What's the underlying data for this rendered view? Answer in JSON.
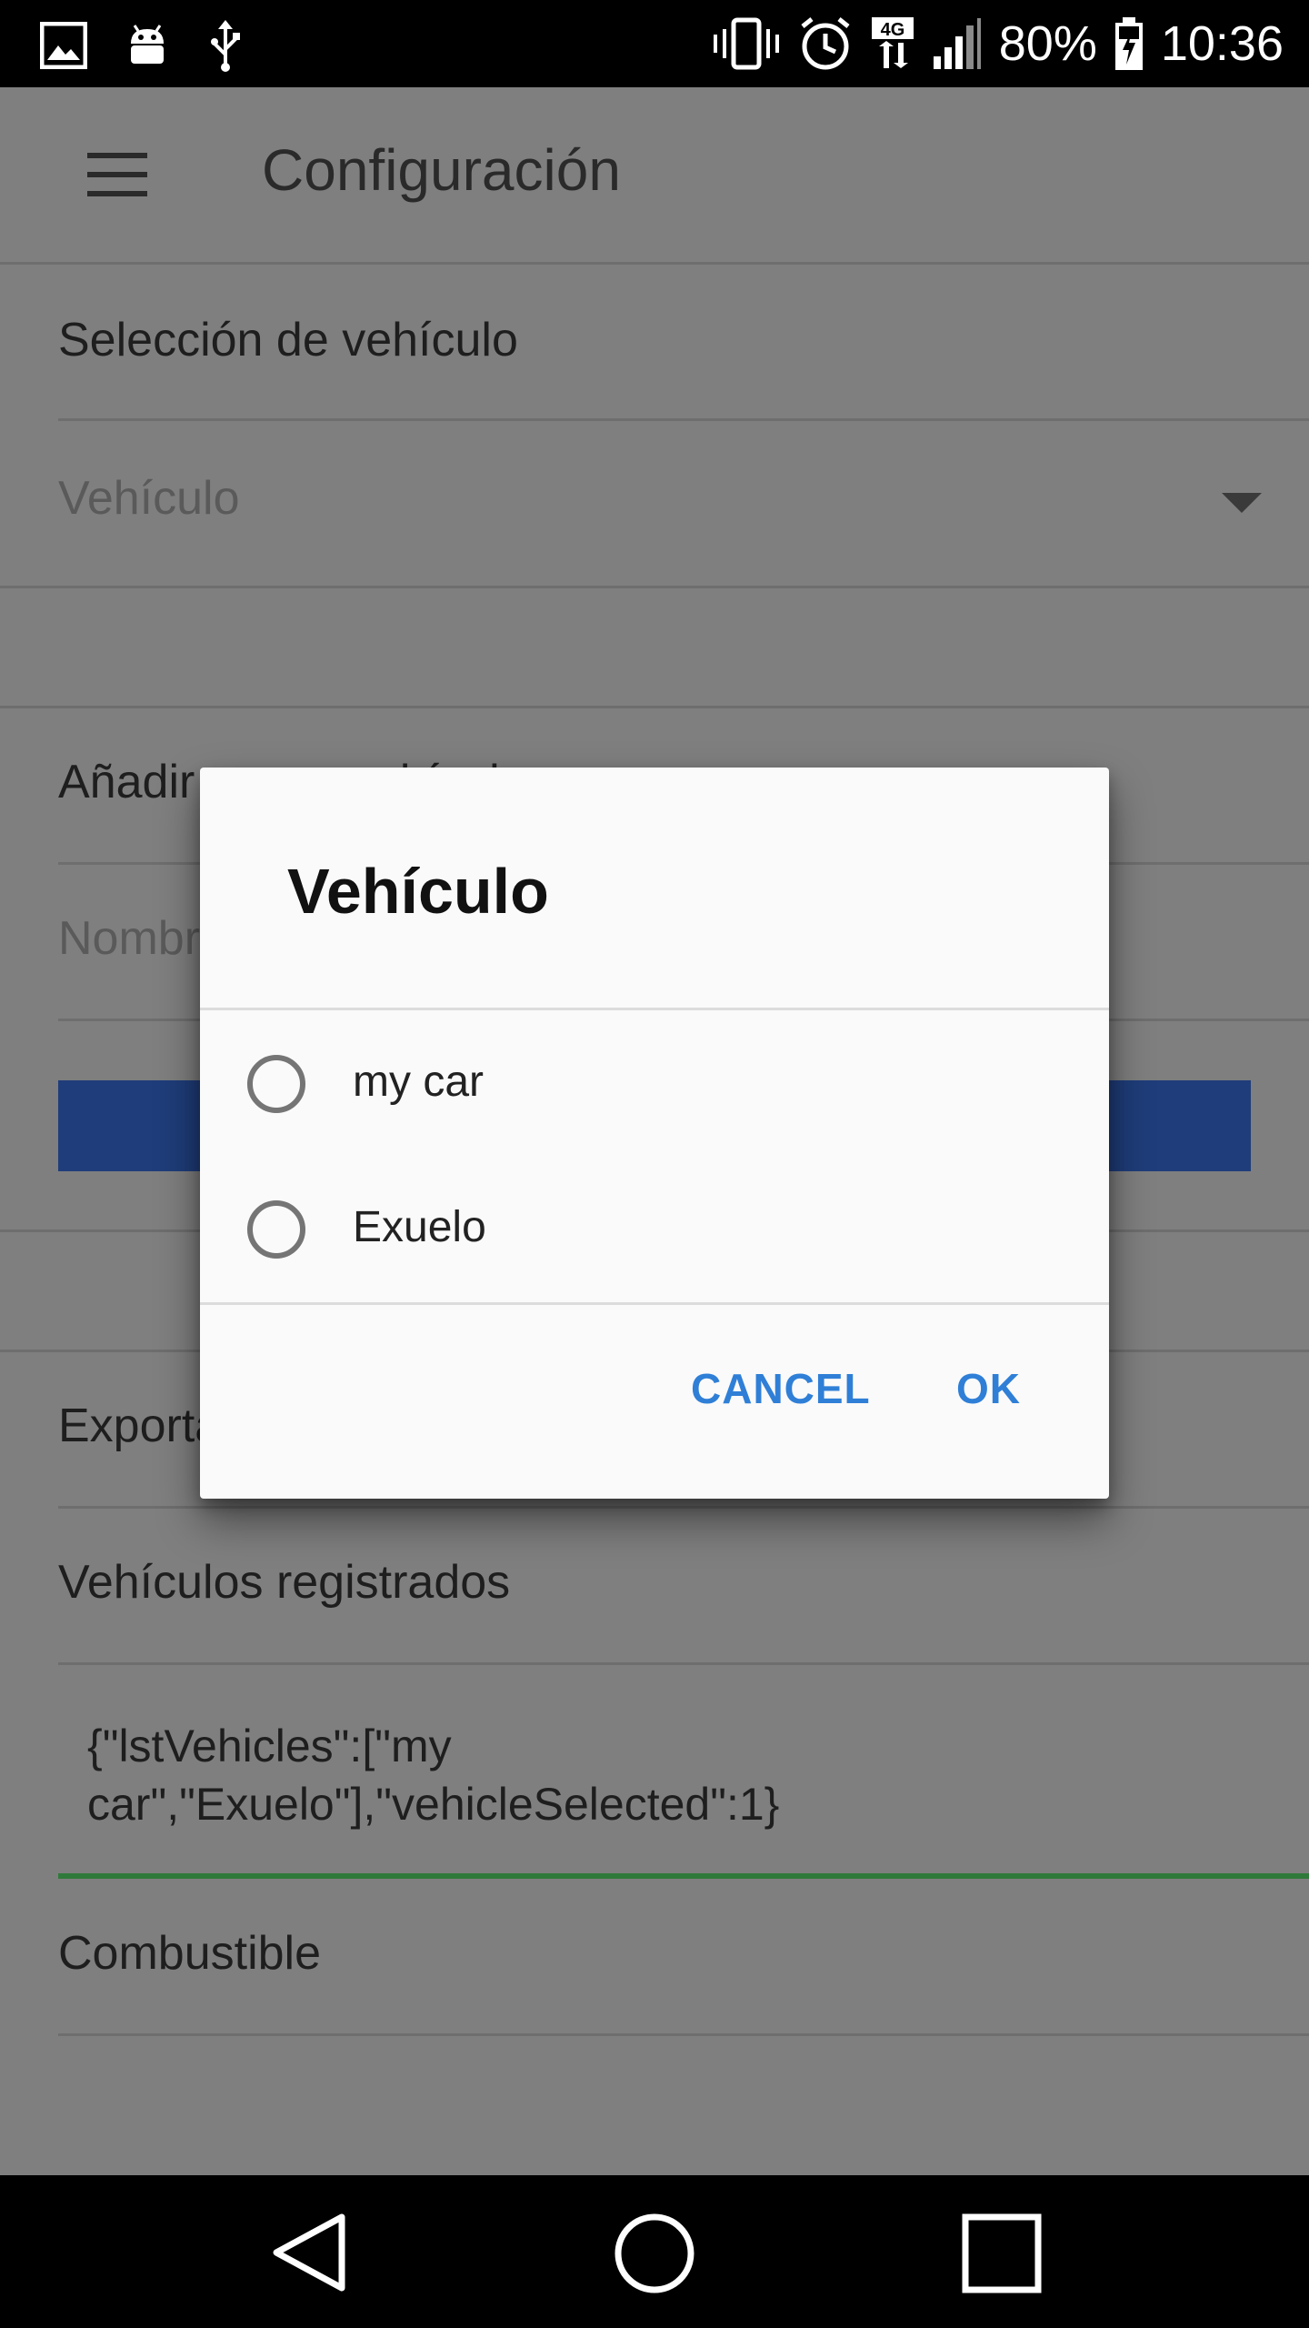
{
  "status_bar": {
    "battery": "80%",
    "time": "10:36",
    "network": "4G",
    "icons": [
      "image-icon",
      "android-icon",
      "usb-icon",
      "vibrate-icon",
      "alarm-icon",
      "network-4g-icon",
      "signal-icon",
      "battery-charging-icon"
    ]
  },
  "toolbar": {
    "title": "Configuración"
  },
  "sections": {
    "vehicle_selection_title": "Selección de vehículo",
    "vehicle_dropdown_hint": "Vehículo",
    "add_vehicle_title": "Añadir nuevo vehículo",
    "name_hint": "Nombre",
    "export_title": "Exportar",
    "registered_title": "Vehículos registrados",
    "registered_json_line1": "{\"lstVehicles\":[\"my",
    "registered_json_line2": "car\",\"Exuelo\"],\"vehicleSelected\":1}",
    "fuel_title": "Combustible"
  },
  "dialog": {
    "title": "Vehículo",
    "options": [
      {
        "label": "my car",
        "selected": false
      },
      {
        "label": "Exuelo",
        "selected": false
      }
    ],
    "cancel_label": "CANCEL",
    "ok_label": "OK"
  },
  "colors": {
    "accent_blue": "#2f7fd7",
    "button_blue": "#1f3d7a",
    "focus_green": "#2f7a3a"
  }
}
